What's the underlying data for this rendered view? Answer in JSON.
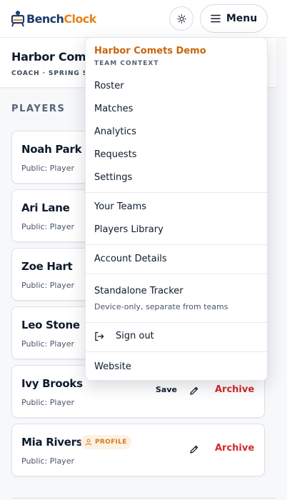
{
  "brand": {
    "name_part1": "Bench",
    "name_part2": "Clock",
    "color_primary": "#1f3b6d",
    "color_accent": "#e8831e"
  },
  "header": {
    "menu_label": "Menu",
    "theme_icon": "sun-icon",
    "menu_icon": "hamburger-icon"
  },
  "team": {
    "title": "Harbor Comets Demo",
    "subtitle": "COACH · SPRING SEASON"
  },
  "players_section": {
    "label": "PLAYERS"
  },
  "players": [
    {
      "name": "Noah Park",
      "role": "Public: Player"
    },
    {
      "name": "Ari Lane",
      "role": "Public: Player"
    },
    {
      "name": "Zoe Hart",
      "role": "Public: Player"
    },
    {
      "name": "Leo Stone",
      "role": "Public: Player"
    },
    {
      "name": "Ivy Brooks",
      "role": "Public: Player",
      "save_label": "Save",
      "archive_label": "Archive"
    },
    {
      "name": "Mia Rivers",
      "role": "Public: Player",
      "badge": "PROFILE",
      "archive_label": "Archive"
    }
  ],
  "dropdown": {
    "team_name": "Harbor Comets Demo",
    "context_label": "TEAM CONTEXT",
    "team_items": [
      "Roster",
      "Matches",
      "Analytics",
      "Requests",
      "Settings"
    ],
    "library_items": [
      "Your Teams",
      "Players Library"
    ],
    "account_item": "Account Details",
    "tracker": {
      "label": "Standalone Tracker",
      "description": "Device-only, separate from teams"
    },
    "signout_label": "Sign out",
    "website_label": "Website"
  },
  "colors": {
    "archive": "#d42a2a",
    "team_accent": "#c9640c",
    "badge_bg": "#fdf1e3"
  }
}
